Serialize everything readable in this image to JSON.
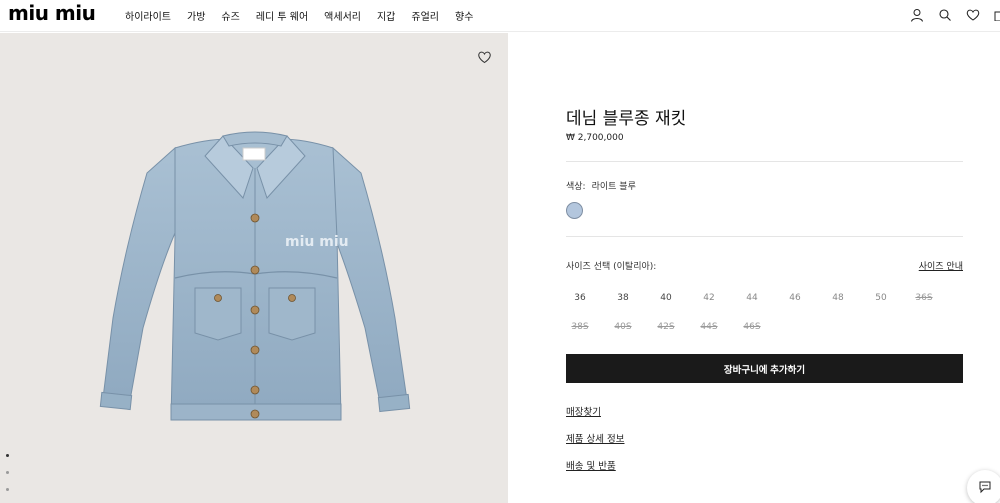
{
  "header": {
    "logo": "miu miu",
    "nav": [
      "하이라이트",
      "가방",
      "슈즈",
      "레디 투 웨어",
      "액세서리",
      "지갑",
      "쥬얼리",
      "향수"
    ],
    "icons": [
      "user-icon",
      "search-icon",
      "heart-icon",
      "bag-icon"
    ]
  },
  "gallery": {
    "wishlist_icon": "heart-icon",
    "pager_count": 3,
    "active_index": 0
  },
  "product": {
    "title": "데님 블루종 재킷",
    "price": "₩ 2,700,000",
    "color_label": "색상:",
    "color_value": "라이트 블루",
    "swatch_color": "#b3c6dd",
    "size_label": "사이즈 선택 (이탈리아):",
    "size_guide": "사이즈 안내",
    "sizes_row1": [
      {
        "label": "36",
        "available": true
      },
      {
        "label": "38",
        "available": true
      },
      {
        "label": "40",
        "available": true
      },
      {
        "label": "42",
        "available": false
      },
      {
        "label": "44",
        "available": false
      },
      {
        "label": "46",
        "available": false
      },
      {
        "label": "48",
        "available": false
      },
      {
        "label": "50",
        "available": false
      },
      {
        "label": "36S",
        "available": false
      }
    ],
    "sizes_row2": [
      {
        "label": "38S",
        "available": false
      },
      {
        "label": "40S",
        "available": false
      },
      {
        "label": "42S",
        "available": false
      },
      {
        "label": "44S",
        "available": false
      },
      {
        "label": "46S",
        "available": false
      }
    ],
    "add_to_cart": "장바구니에 추가하기",
    "links": [
      "매장찾기",
      "제품 상세 정보",
      "배송 및 반품"
    ]
  }
}
